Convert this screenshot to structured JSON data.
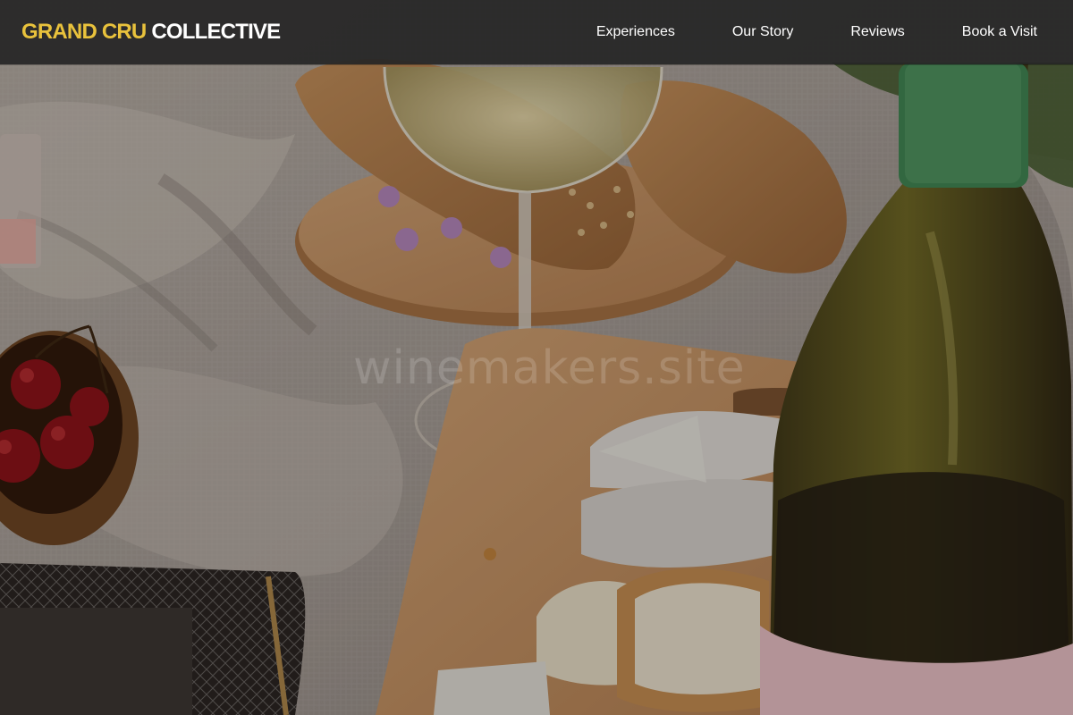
{
  "brand": {
    "accent": "GRAND CRU",
    "rest": "COLLECTIVE",
    "accent_color": "#e9c23c"
  },
  "nav": {
    "items": [
      {
        "id": "experiences",
        "label": "Experiences"
      },
      {
        "id": "our-story",
        "label": "Our Story"
      },
      {
        "id": "reviews",
        "label": "Reviews"
      },
      {
        "id": "book-a-visit",
        "label": "Book a Visit"
      }
    ]
  },
  "hero": {
    "image_subject": "picnic blanket with bread, wine glass, cheese board, cherries and wine bottle",
    "watermark": "winemakers.site"
  }
}
